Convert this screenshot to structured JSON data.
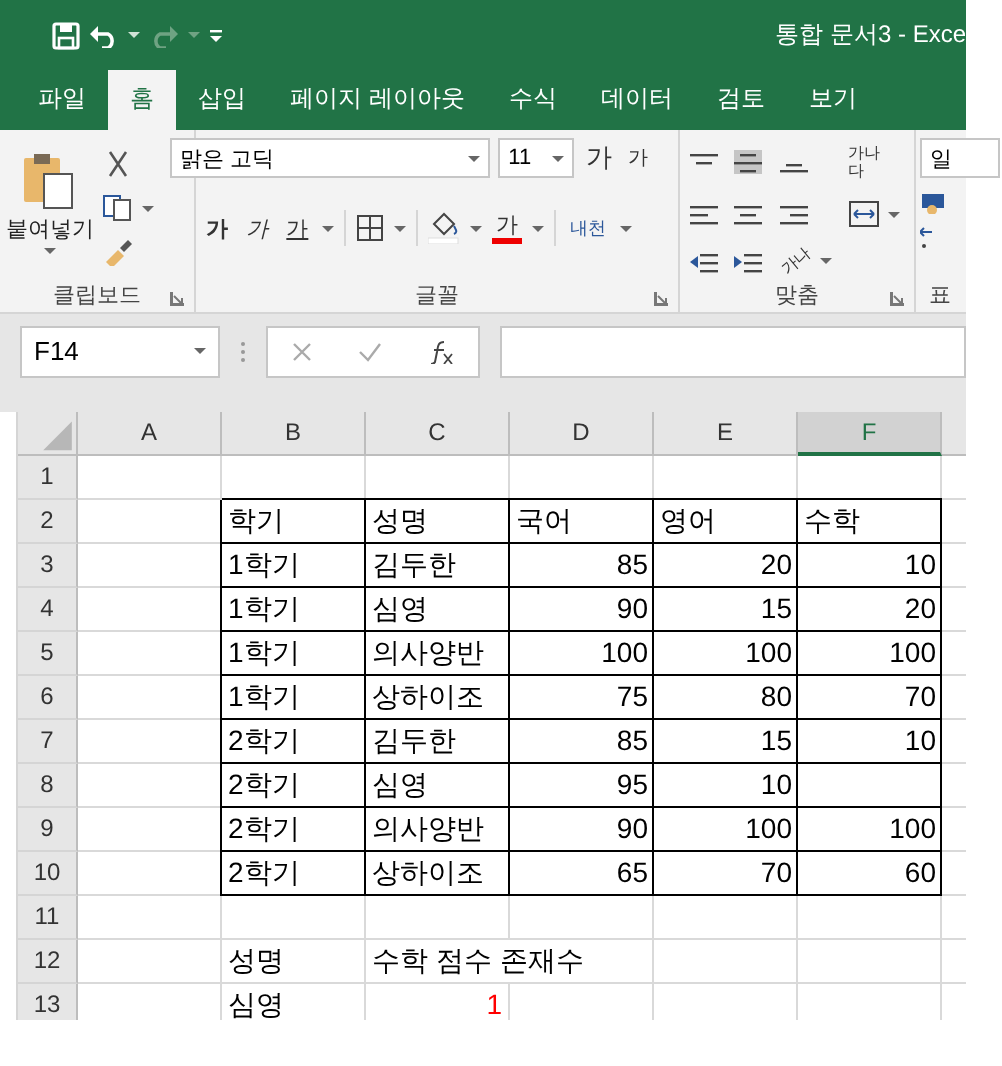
{
  "title_bar": {
    "title": "통합 문서3  -  Exce"
  },
  "tabs": [
    {
      "label": "파일",
      "selected": false
    },
    {
      "label": "홈",
      "selected": true
    },
    {
      "label": "삽입",
      "selected": false
    },
    {
      "label": "페이지 레이아웃",
      "selected": false
    },
    {
      "label": "수식",
      "selected": false
    },
    {
      "label": "데이터",
      "selected": false
    },
    {
      "label": "검토",
      "selected": false
    },
    {
      "label": "보기",
      "selected": false
    }
  ],
  "ribbon": {
    "clipboard": {
      "paste_label": "붙여넣기",
      "label": "클립보드"
    },
    "font": {
      "font_name": "맑은 고딕",
      "font_size": "11",
      "grow_label": "가",
      "shrink_label": "가",
      "style_buttons": [
        "가",
        "가",
        "가"
      ],
      "font_color_label": "가",
      "phonetic_label": "내천",
      "label": "글꼴"
    },
    "alignment": {
      "wrap_label": "가나다",
      "orientation_label": "가나",
      "label": "맞춤"
    },
    "number": {
      "format_value": "일",
      "label": "표"
    }
  },
  "name_box": "F14",
  "columns": [
    {
      "label": "A",
      "selected": false
    },
    {
      "label": "B",
      "selected": false
    },
    {
      "label": "C",
      "selected": false
    },
    {
      "label": "D",
      "selected": false
    },
    {
      "label": "E",
      "selected": false
    },
    {
      "label": "F",
      "selected": true
    }
  ],
  "rows": [
    {
      "label": "1",
      "bordered": false,
      "cells": [
        null,
        null,
        null,
        null,
        null,
        null
      ]
    },
    {
      "label": "2",
      "bordered": true,
      "cells": [
        null,
        {
          "text": "학기",
          "numeric": false
        },
        {
          "text": "성명",
          "numeric": false
        },
        {
          "text": "국어",
          "numeric": false
        },
        {
          "text": "영어",
          "numeric": false
        },
        {
          "text": "수학",
          "numeric": false
        }
      ]
    },
    {
      "label": "3",
      "bordered": true,
      "cells": [
        null,
        {
          "text": "1학기",
          "numeric": false
        },
        {
          "text": "김두한",
          "numeric": false
        },
        {
          "text": "85",
          "numeric": true
        },
        {
          "text": "20",
          "numeric": true
        },
        {
          "text": "10",
          "numeric": true
        }
      ]
    },
    {
      "label": "4",
      "bordered": true,
      "cells": [
        null,
        {
          "text": "1학기",
          "numeric": false
        },
        {
          "text": "심영",
          "numeric": false
        },
        {
          "text": "90",
          "numeric": true
        },
        {
          "text": "15",
          "numeric": true
        },
        {
          "text": "20",
          "numeric": true
        }
      ]
    },
    {
      "label": "5",
      "bordered": true,
      "cells": [
        null,
        {
          "text": "1학기",
          "numeric": false
        },
        {
          "text": "의사양반",
          "numeric": false
        },
        {
          "text": "100",
          "numeric": true
        },
        {
          "text": "100",
          "numeric": true
        },
        {
          "text": "100",
          "numeric": true
        }
      ]
    },
    {
      "label": "6",
      "bordered": true,
      "cells": [
        null,
        {
          "text": "1학기",
          "numeric": false
        },
        {
          "text": "상하이조",
          "numeric": false
        },
        {
          "text": "75",
          "numeric": true
        },
        {
          "text": "80",
          "numeric": true
        },
        {
          "text": "70",
          "numeric": true
        }
      ]
    },
    {
      "label": "7",
      "bordered": true,
      "cells": [
        null,
        {
          "text": "2학기",
          "numeric": false
        },
        {
          "text": "김두한",
          "numeric": false
        },
        {
          "text": "85",
          "numeric": true
        },
        {
          "text": "15",
          "numeric": true
        },
        {
          "text": "10",
          "numeric": true
        }
      ]
    },
    {
      "label": "8",
      "bordered": true,
      "cells": [
        null,
        {
          "text": "2학기",
          "numeric": false
        },
        {
          "text": "심영",
          "numeric": false
        },
        {
          "text": "95",
          "numeric": true
        },
        {
          "text": "10",
          "numeric": true
        },
        null
      ]
    },
    {
      "label": "9",
      "bordered": true,
      "cells": [
        null,
        {
          "text": "2학기",
          "numeric": false
        },
        {
          "text": "의사양반",
          "numeric": false
        },
        {
          "text": "90",
          "numeric": true
        },
        {
          "text": "100",
          "numeric": true
        },
        {
          "text": "100",
          "numeric": true
        }
      ]
    },
    {
      "label": "10",
      "bordered": true,
      "cells": [
        null,
        {
          "text": "2학기",
          "numeric": false
        },
        {
          "text": "상하이조",
          "numeric": false
        },
        {
          "text": "65",
          "numeric": true
        },
        {
          "text": "70",
          "numeric": true
        },
        {
          "text": "60",
          "numeric": true
        }
      ]
    },
    {
      "label": "11",
      "bordered": false,
      "cells": [
        null,
        null,
        null,
        null,
        null,
        null
      ]
    },
    {
      "label": "12",
      "bordered": false,
      "cells": [
        null,
        {
          "text": "성명",
          "numeric": false
        },
        {
          "text": "수학 점수 존재수",
          "numeric": false
        },
        null,
        null,
        null
      ]
    },
    {
      "label": "13",
      "bordered": false,
      "cells": [
        null,
        {
          "text": "심영",
          "numeric": false
        },
        {
          "text": "1",
          "numeric": true,
          "color": "#ff0000"
        },
        null,
        null,
        null
      ]
    }
  ]
}
